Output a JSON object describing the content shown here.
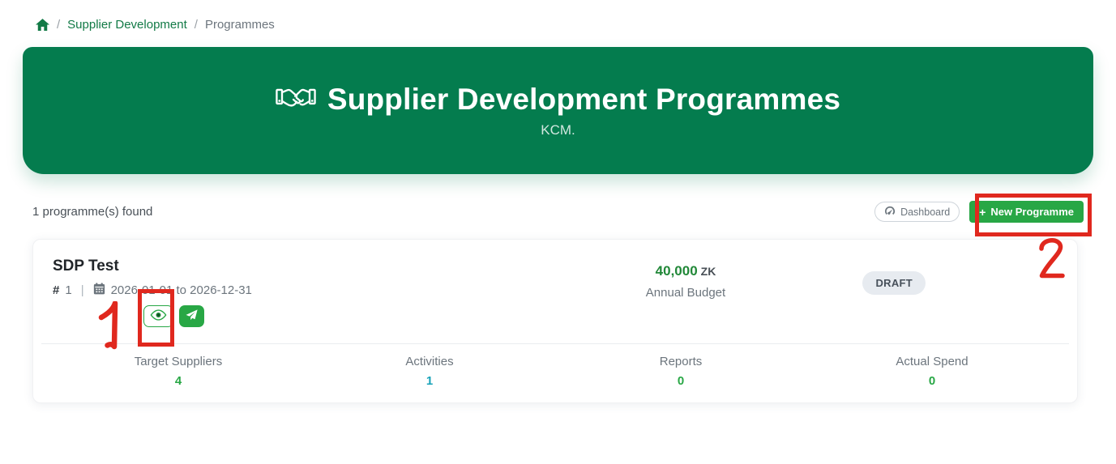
{
  "breadcrumb": {
    "separator": "/",
    "items": [
      {
        "label": "Supplier Development"
      },
      {
        "label": "Programmes"
      }
    ]
  },
  "banner": {
    "title": "Supplier Development Programmes",
    "subtitle": "KCM."
  },
  "toolbar": {
    "results_text": "1 programme(s) found",
    "dashboard_label": "Dashboard",
    "new_programme_plus": "+",
    "new_programme_label": "New Programme"
  },
  "programme_card": {
    "title": "SDP Test",
    "hash": "#",
    "number": "1",
    "pipe": "|",
    "date_range": "2026-01-01 to 2026-12-31",
    "budget_amount": "40,000",
    "budget_currency": "ZK",
    "budget_label": "Annual Budget",
    "status": "DRAFT",
    "stats": [
      {
        "label": "Target Suppliers",
        "value": "4",
        "color": "#28a745"
      },
      {
        "label": "Activities",
        "value": "1",
        "color": "#17a2b8"
      },
      {
        "label": "Reports",
        "value": "0",
        "color": "#28a745"
      },
      {
        "label": "Actual Spend",
        "value": "0",
        "color": "#28a745"
      }
    ]
  },
  "annotations": {
    "step1": "1",
    "step2": "2"
  },
  "colors": {
    "banner_green": "#047c4e",
    "breadcrumb_green": "#127a46",
    "button_green": "#28a745",
    "activities_teal": "#17a2b8",
    "annotation_red": "#e0281e",
    "badge_bg": "#e7ebf0"
  }
}
